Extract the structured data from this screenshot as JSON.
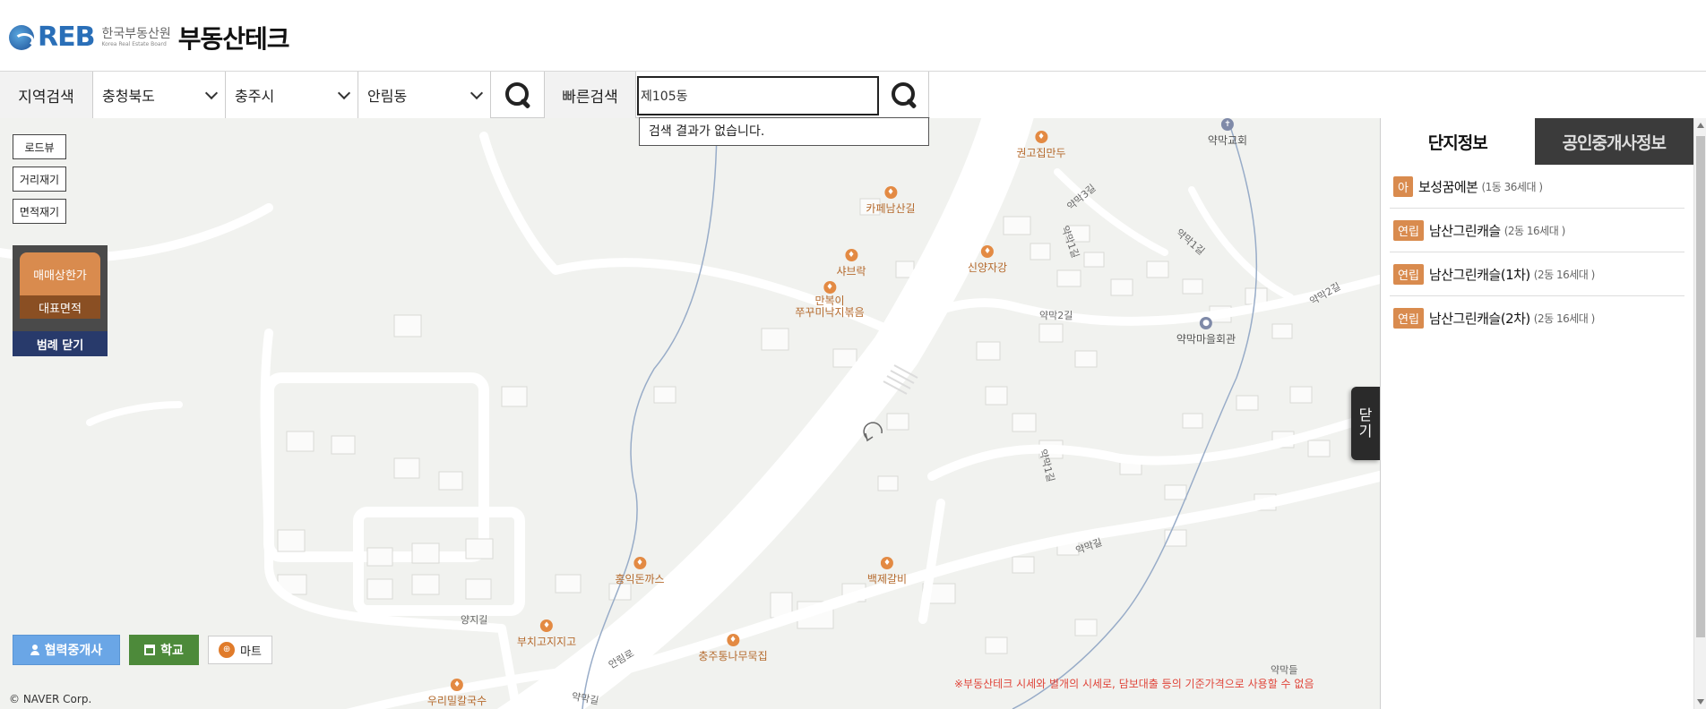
{
  "header": {
    "logo_brand": "REB",
    "logo_org_ko": "한국부동산원",
    "logo_org_en": "Korea Real Estate Board",
    "logo_service": "부동산테크"
  },
  "search": {
    "region_label": "지역검색",
    "province": "충청북도",
    "city": "충주시",
    "dong": "안림동",
    "quick_label": "빠른검색",
    "quick_value": "제105동",
    "no_result": "검색 결과가 없습니다."
  },
  "map": {
    "tools": [
      "로드뷰",
      "거리재기",
      "면적재기"
    ],
    "legend": {
      "price": "매매상한가",
      "area": "대표면적",
      "close": "범례 닫기"
    },
    "pois": [
      {
        "name": "권고집만두",
        "kind": "food"
      },
      {
        "name": "카페남산길",
        "kind": "cafe"
      },
      {
        "name": "샤브락",
        "kind": "food"
      },
      {
        "name": "신양자강",
        "kind": "food"
      },
      {
        "name": "만복이\n쭈꾸미낙지볶음",
        "kind": "food"
      },
      {
        "name": "약막교회",
        "kind": "church"
      },
      {
        "name": "약막마을회관",
        "kind": "public"
      },
      {
        "name": "홍익돈까스",
        "kind": "food"
      },
      {
        "name": "백제갈비",
        "kind": "food"
      },
      {
        "name": "부치고지지고",
        "kind": "food"
      },
      {
        "name": "충주통나무묵집",
        "kind": "food"
      },
      {
        "name": "우리밀칼국수",
        "kind": "food"
      }
    ],
    "road_labels": [
      "약막3길",
      "약막1길",
      "약막2길",
      "약막1길",
      "약막1길",
      "약막길",
      "약막2길",
      "안림로",
      "양지길",
      "약막길",
      "약막들"
    ],
    "bottom_buttons": {
      "broker": "협력중개사",
      "school": "학교",
      "mart": "마트"
    },
    "copyright": "© NAVER Corp.",
    "disclaimer": "※부동산테크 시세와 별개의 시세로, 담보대출 등의 기준가격으로 사용할 수 없음",
    "side_toggle": "닫\n기"
  },
  "panel": {
    "tabs": [
      {
        "label": "단지정보",
        "active": true
      },
      {
        "label": "공인중개사정보",
        "active": false
      }
    ],
    "items": [
      {
        "badge": "아",
        "name": "보성꿈에본",
        "info": "(1동 36세대 )"
      },
      {
        "badge": "연립",
        "name": "남산그린캐슬",
        "info": "(2동 16세대 )"
      },
      {
        "badge": "연립",
        "name": "남산그린캐슬(1차)",
        "info": "(2동 16세대 )"
      },
      {
        "badge": "연립",
        "name": "남산그린캐슬(2차)",
        "info": "(2동 16세대 )"
      }
    ]
  },
  "colors": {
    "accent_orange": "#d98b4e",
    "legend_navy": "#283a6b",
    "broker_blue": "#6aa6e6",
    "school_green": "#4d8a3a",
    "disclaimer_red": "#e0453a"
  }
}
